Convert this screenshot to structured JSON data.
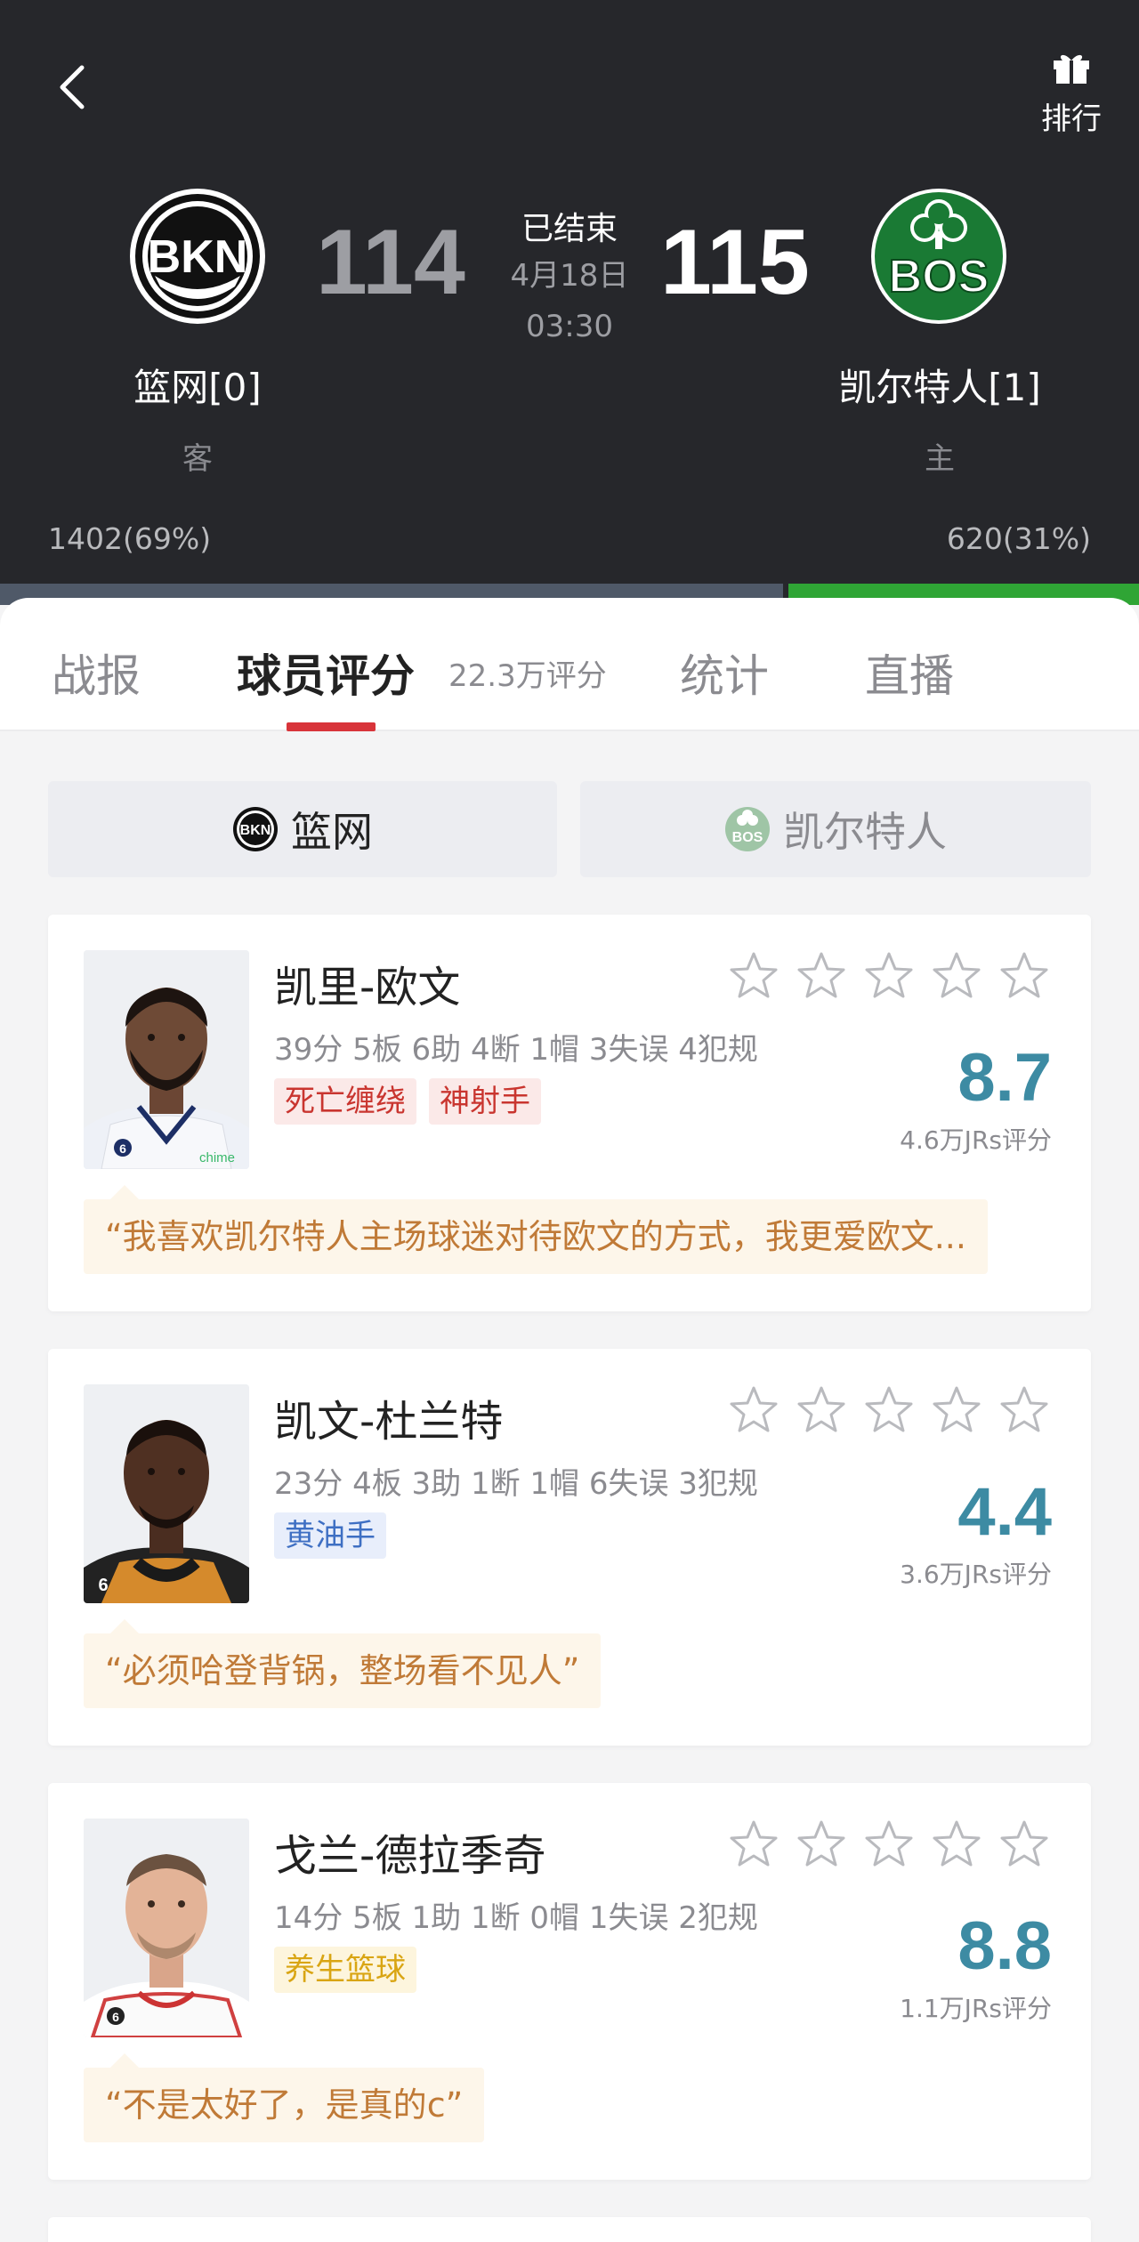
{
  "header": {
    "rank_label": "排行",
    "away": {
      "abbr": "BKN",
      "name": "篮网[0]",
      "role": "客",
      "score": "114",
      "support": "1402(69%)",
      "support_fraction": 0.69
    },
    "home": {
      "abbr": "BOS",
      "name": "凯尔特人[1]",
      "role": "主",
      "score": "115",
      "support": "620(31%)",
      "support_fraction": 0.31
    },
    "status": "已结束",
    "date": "4月18日",
    "time": "03:30"
  },
  "tabs": [
    {
      "label": "战报"
    },
    {
      "label": "球员评分",
      "sub": "22.3万评分",
      "active": true
    },
    {
      "label": "统计"
    },
    {
      "label": "直播"
    }
  ],
  "team_toggle": {
    "bkn": "篮网",
    "bos": "凯尔特人"
  },
  "players": [
    {
      "name": "凯里-欧文",
      "stats": "39分 5板 6助 4断 1帽 3失误 4犯规",
      "tags": [
        "死亡缠绕",
        "神射手"
      ],
      "rating": "8.7",
      "rating_count": "4.6万JRs评分",
      "comment": "“我喜欢凯尔特人主场球迷对待欧文的方式，我更爱欧文...",
      "jersey_number": "6",
      "jersey_sponsor": "chime"
    },
    {
      "name": "凯文-杜兰特",
      "stats": "23分 4板 3助 1断 1帽 6失误 3犯规",
      "tags": [
        "黄油手"
      ],
      "rating": "4.4",
      "rating_count": "3.6万JRs评分",
      "comment": "“必须哈登背锅，整场看不见人”",
      "jersey_number": "6"
    },
    {
      "name": "戈兰-德拉季奇",
      "stats": "14分 5板 1助 1断 0帽 1失误 2犯规",
      "tags": [
        "养生篮球"
      ],
      "rating": "8.8",
      "rating_count": "1.1万JRs评分",
      "comment": "“不是太好了，是真的c”",
      "jersey_number": "6"
    }
  ]
}
